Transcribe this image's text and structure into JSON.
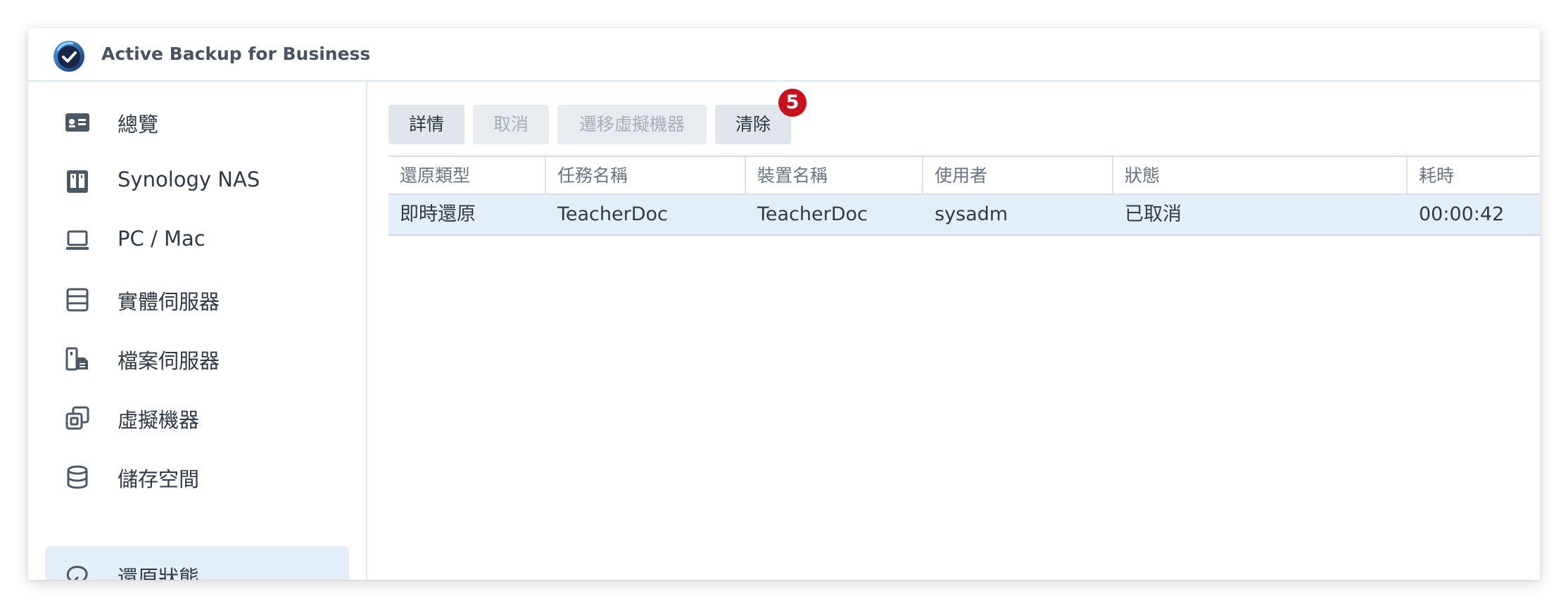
{
  "app": {
    "title": "Active Backup for Business"
  },
  "sidebar": {
    "items": [
      {
        "label": "總覽",
        "icon": "overview-card-icon"
      },
      {
        "label": "Synology NAS",
        "icon": "nas-icon"
      },
      {
        "label": "PC / Mac",
        "icon": "laptop-icon"
      },
      {
        "label": "實體伺服器",
        "icon": "server-icon"
      },
      {
        "label": "檔案伺服器",
        "icon": "file-server-icon"
      },
      {
        "label": "虛擬機器",
        "icon": "virtual-machine-icon"
      },
      {
        "label": "儲存空間",
        "icon": "database-icon"
      },
      {
        "label": "還原狀態",
        "icon": "restore-icon",
        "active": true
      }
    ]
  },
  "toolbar": {
    "details_label": "詳情",
    "cancel_label": "取消",
    "migrate_label": "遷移虛擬機器",
    "clear_label": "清除",
    "badge": "5"
  },
  "table": {
    "columns": [
      "還原類型",
      "任務名稱",
      "裝置名稱",
      "使用者",
      "狀態",
      "耗時"
    ],
    "rows": [
      {
        "restore_type": "即時還原",
        "task_name": "TeacherDoc",
        "device_name": "TeacherDoc",
        "user": "sysadm",
        "status": "已取消",
        "duration": "00:00:42"
      }
    ]
  },
  "colors": {
    "accent": "#e4eefb",
    "badge": "#c8101e",
    "text": "#2f3947"
  }
}
